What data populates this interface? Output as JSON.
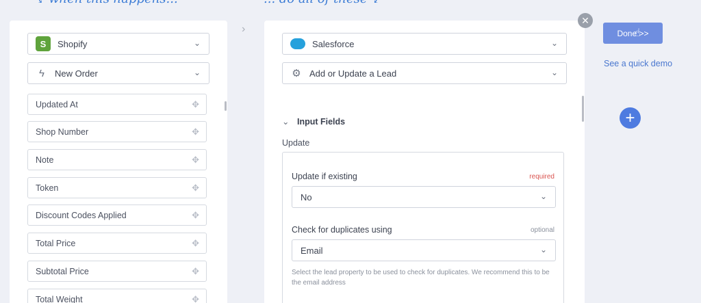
{
  "hints": {
    "left": "when this happens...",
    "right": "... do all of these"
  },
  "trigger": {
    "app_label": "Shopify",
    "event_label": "New Order",
    "fields": [
      "Updated At",
      "Shop Number",
      "Note",
      "Token",
      "Discount Codes Applied",
      "Total Price",
      "Subtotal Price",
      "Total Weight"
    ]
  },
  "action": {
    "app_label": "Salesforce",
    "event_label": "Add or Update a Lead",
    "section_title": "Input Fields",
    "group_label": "Update",
    "update_if_existing": {
      "label": "Update if existing",
      "badge": "required",
      "value": "No"
    },
    "check_duplicates": {
      "label": "Check for duplicates using",
      "badge": "optional",
      "value": "Email",
      "help": "Select the lead property to be used to check for duplicates. We recommend this to be the email address"
    }
  },
  "side": {
    "done_label": "Done >>",
    "demo_label": "See a quick demo"
  },
  "icons": {
    "close": "close-icon",
    "add": "plus-icon",
    "gear": "gear-icon",
    "bolt": "bolt-icon",
    "drag": "drag-handle-icon"
  },
  "colors": {
    "accent": "#4e7be0",
    "done_button": "#6f8ee0",
    "required": "#d9534f",
    "shopify": "#5fa33c",
    "salesforce": "#26a1dc"
  }
}
